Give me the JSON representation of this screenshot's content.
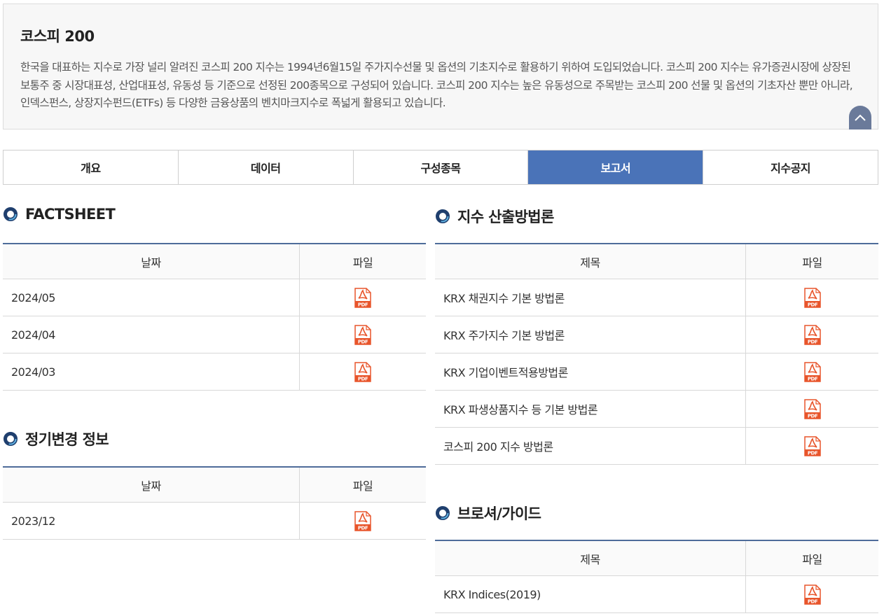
{
  "intro": {
    "title": "코스피 200",
    "description": "한국을 대표하는 지수로 가장 널리 알려진 코스피 200 지수는 1994년6월15일 주가지수선물 및 옵션의 기초지수로 활용하기 위하여 도입되었습니다. 코스피 200 지수는 유가증권시장에 상장된 보통주 중 시장대표성, 산업대표성, 유동성 등 기준으로 선정된 200종목으로 구성되어 있습니다. 코스피 200 지수는 높은 유동성으로 주목받는 코스피 200 선물 및 옵션의 기초자산 뿐만 아니라, 인덱스펀스, 상장지수펀드(ETFs) 등 다양한 금융상품의 벤치마크지수로 폭넓게 활용되고 있습니다.",
    "collapse_icon": "chevron-up-icon"
  },
  "tabs": [
    {
      "label": "개요",
      "active": false
    },
    {
      "label": "데이터",
      "active": false
    },
    {
      "label": "구성종목",
      "active": false
    },
    {
      "label": "보고서",
      "active": true
    },
    {
      "label": "지수공지",
      "active": false
    }
  ],
  "colors": {
    "accent": "#4a73b8",
    "table_border": "#4e6c9a",
    "pdf_red": "#e8552b"
  },
  "factsheet": {
    "title": "FACTSHEET",
    "headers": [
      "날짜",
      "파일"
    ],
    "rows": [
      "2024/05",
      "2024/04",
      "2024/03"
    ]
  },
  "regular_change": {
    "title": "정기변경 정보",
    "headers": [
      "날짜",
      "파일"
    ],
    "rows": [
      "2023/12"
    ]
  },
  "methodology": {
    "title": "지수 산출방법론",
    "headers": [
      "제목",
      "파일"
    ],
    "rows": [
      "KRX 채권지수 기본 방법론",
      "KRX 주가지수 기본 방법론",
      "KRX 기업이벤트적용방법론",
      "KRX 파생상품지수 등 기본 방법론",
      "코스피 200 지수 방법론"
    ]
  },
  "brochure": {
    "title": "브로셔/가이드",
    "headers": [
      "제목",
      "파일"
    ],
    "rows": [
      "KRX Indices(2019)"
    ]
  },
  "file_icon": {
    "name": "pdf-icon",
    "label": "PDF"
  }
}
